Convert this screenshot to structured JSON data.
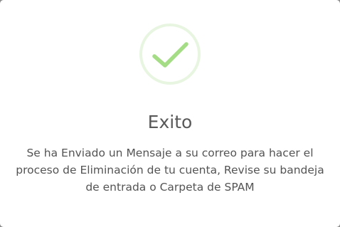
{
  "dialog": {
    "title": "Exito",
    "message": "Se ha Enviado un Mensaje a su correo para hacer el proceso de Eliminación de tu cuenta, Revise su bandeja de entrada o Carpeta de SPAM",
    "icon": "success-checkmark-icon",
    "colors": {
      "check": "#a5dc86",
      "ring": "rgba(165, 220, 134, 0.25)",
      "title": "#595959",
      "text": "#545454"
    }
  }
}
